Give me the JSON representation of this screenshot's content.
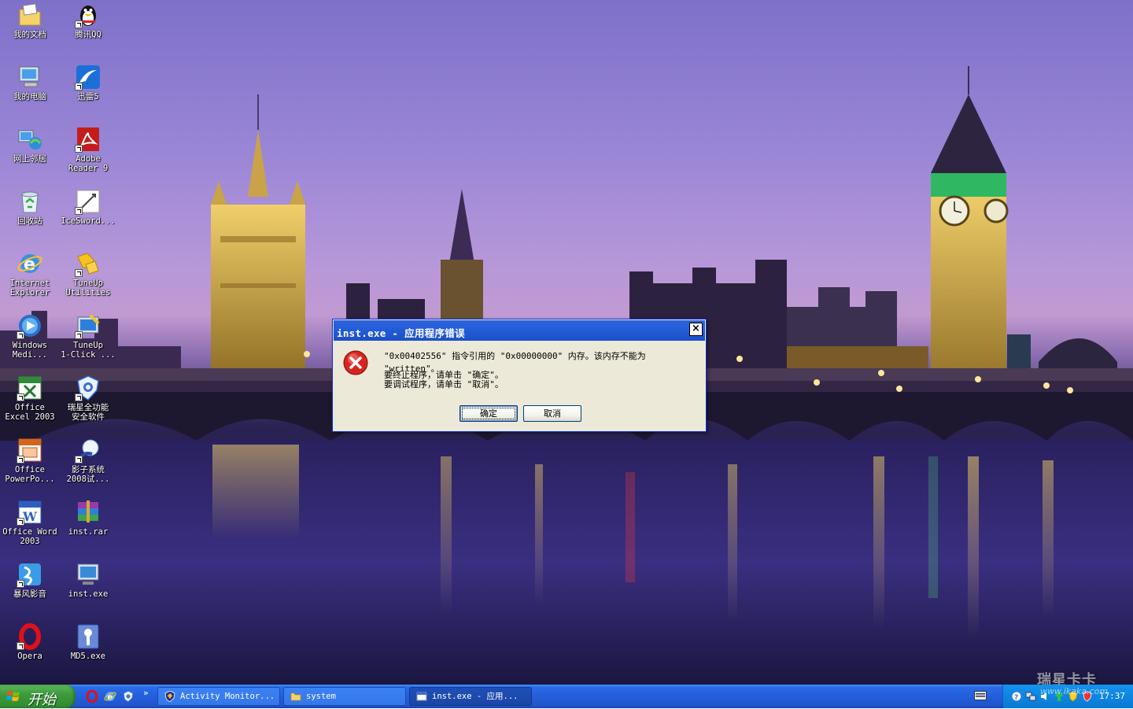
{
  "desktop_icons": [
    {
      "name": "mydocs-icon",
      "label": "我的文档",
      "shortcut": false
    },
    {
      "name": "qq-icon",
      "label": "腾讯QQ",
      "shortcut": true
    },
    {
      "name": "mycomputer-icon",
      "label": "我的电脑",
      "shortcut": false
    },
    {
      "name": "xunlei-icon",
      "label": "迅雷5",
      "shortcut": true
    },
    {
      "name": "network-icon",
      "label": "网上邻居",
      "shortcut": false
    },
    {
      "name": "adobe-reader-icon",
      "label": "Adobe\nReader 9",
      "shortcut": true
    },
    {
      "name": "recycle-bin-icon",
      "label": "回收站",
      "shortcut": false
    },
    {
      "name": "icesword-icon",
      "label": "IceSword...",
      "shortcut": true
    },
    {
      "name": "internet-explorer-icon",
      "label": "Internet\nExplorer",
      "shortcut": false
    },
    {
      "name": "tuneup-utilities-icon",
      "label": "TuneUp\nUtilities",
      "shortcut": true
    },
    {
      "name": "windows-media-icon",
      "label": "Windows\nMedi...",
      "shortcut": true
    },
    {
      "name": "tuneup-1click-icon",
      "label": "TuneUp\n1-Click ...",
      "shortcut": true
    },
    {
      "name": "excel-icon",
      "label": "Office\nExcel 2003",
      "shortcut": true
    },
    {
      "name": "rising-security-icon",
      "label": "瑞星全功能\n安全软件",
      "shortcut": true
    },
    {
      "name": "powerpoint-icon",
      "label": "Office\nPowerPo...",
      "shortcut": true
    },
    {
      "name": "shadow-system-icon",
      "label": "影子系统\n2008试...",
      "shortcut": true
    },
    {
      "name": "word-icon",
      "label": "Office Word\n2003",
      "shortcut": true
    },
    {
      "name": "rar-file-icon",
      "label": "inst.rar",
      "shortcut": false
    },
    {
      "name": "baofeng-icon",
      "label": "暴风影音",
      "shortcut": true
    },
    {
      "name": "inst-exe-icon",
      "label": "inst.exe",
      "shortcut": false
    },
    {
      "name": "opera-icon",
      "label": "Opera",
      "shortcut": true
    },
    {
      "name": "md5-exe-icon",
      "label": "MD5.exe",
      "shortcut": false
    }
  ],
  "dialog": {
    "title": "inst.exe - 应用程序错误",
    "close": "×",
    "message": "\"0x00402556\" 指令引用的 \"0x00000000\" 内存。该内存不能为 \"written\"。",
    "line2": "要终止程序，请单击 \"确定\"。",
    "line3": "要调试程序，请单击 \"取消\"。",
    "ok_label": "确定",
    "cancel_label": "取消"
  },
  "taskbar": {
    "start_label": "开始",
    "quick_launch_chevron": "»",
    "tasks": [
      {
        "label": "Activity Monitor...",
        "active": false
      },
      {
        "label": "system",
        "active": false
      },
      {
        "label": "inst.exe - 应用...",
        "active": true
      }
    ],
    "clock": "17:37"
  },
  "watermark": {
    "logo": "瑞星卡卡",
    "url": "www.ikaka.com"
  },
  "colors": {
    "taskbar_blue": "#245edb",
    "start_green": "#3c9c3c",
    "tray_blue": "#0c86e2",
    "dialog_face": "#ece9d8",
    "error_red": "#d8241d"
  }
}
